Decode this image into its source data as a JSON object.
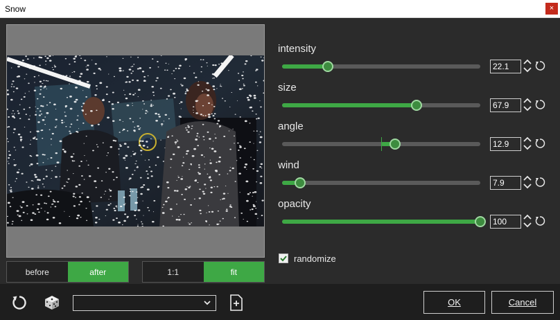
{
  "window": {
    "title": "Snow",
    "close_label": "×"
  },
  "view": {
    "compare": [
      {
        "label": "before",
        "active": false
      },
      {
        "label": "after",
        "active": true
      }
    ],
    "zoom": [
      {
        "label": "1:1",
        "active": false
      },
      {
        "label": "fit",
        "active": true
      }
    ]
  },
  "params": [
    {
      "label": "intensity",
      "value": "22.1",
      "fraction": 0.23,
      "centered": false
    },
    {
      "label": "size",
      "value": "67.9",
      "fraction": 0.679,
      "centered": false
    },
    {
      "label": "angle",
      "value": "12.9",
      "fraction": 0.57,
      "centered": true
    },
    {
      "label": "wind",
      "value": "7.9",
      "fraction": 0.09,
      "centered": false
    },
    {
      "label": "opacity",
      "value": "100",
      "fraction": 1.0,
      "centered": false
    }
  ],
  "randomize": {
    "label": "randomize",
    "checked": true
  },
  "footer": {
    "preset_value": "",
    "icons": [
      "reset-all-icon",
      "dice-icon",
      "new-preset-icon"
    ],
    "ok_label": "OK",
    "cancel_label": "Cancel"
  },
  "colors": {
    "accent": "#3ea845",
    "close": "#c42b1c",
    "background": "#2b2b2b",
    "footer": "#1e1e1e"
  }
}
